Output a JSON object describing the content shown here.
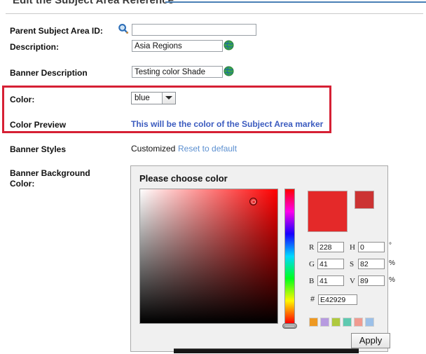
{
  "header": {
    "title": "Edit the Subject Area Reference"
  },
  "form": {
    "parent_subject_area": {
      "label": "Parent Subject Area ID:",
      "value": "",
      "search_icon": "search-icon"
    },
    "description": {
      "label": "Description:",
      "value": "Asia Regions",
      "globe_icon": "globe-icon"
    },
    "banner_description": {
      "label": "Banner Description",
      "value": "Testing color Shade",
      "globe_icon": "globe-icon"
    },
    "color": {
      "label": "Color:",
      "selected": "blue",
      "options": [
        "blue"
      ]
    },
    "color_preview": {
      "label": "Color Preview",
      "text": "This will be the color of the Subject Area marker",
      "text_color": "#3b5bbf"
    },
    "banner_styles": {
      "label": "Banner Styles",
      "status": "Customized",
      "reset_link": "Reset to default"
    },
    "banner_background_color": {
      "label_line1": "Banner Background",
      "label_line2": "Color:"
    }
  },
  "highlight": {
    "name": "red-highlight-box",
    "color": "#d62034"
  },
  "color_dialog": {
    "title": "Please choose color",
    "current_color": "#E42929",
    "preview_large_color": "#E42929",
    "preview_small_color": "#CC3333",
    "channels": [
      {
        "label": "R",
        "value": "228",
        "unit": ""
      },
      {
        "label": "G",
        "value": "41",
        "unit": ""
      },
      {
        "label": "B",
        "value": "41",
        "unit": ""
      }
    ],
    "hsv": [
      {
        "label": "H",
        "value": "0",
        "unit": "°"
      },
      {
        "label": "S",
        "value": "82",
        "unit": "%"
      },
      {
        "label": "V",
        "value": "89",
        "unit": "%"
      }
    ],
    "hex": {
      "symbol": "#",
      "value": "E42929"
    },
    "palette": [
      {
        "name": "palette-swatch-orange",
        "color": "#EE9922"
      },
      {
        "name": "palette-swatch-purple",
        "color": "#B79BE0"
      },
      {
        "name": "palette-swatch-olive",
        "color": "#AFC košt"
      },
      {
        "name": "palette-swatch-teal",
        "color": "#5FC9B0"
      },
      {
        "name": "palette-swatch-salmon",
        "color": "#F09B90"
      },
      {
        "name": "palette-swatch-blue",
        "color": "#9CC0E8"
      }
    ],
    "apply_label": "Apply"
  }
}
